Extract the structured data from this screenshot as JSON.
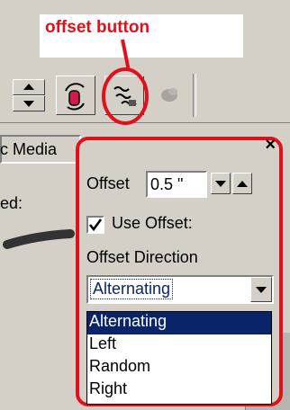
{
  "annotation": {
    "label": "offset button",
    "color": "#e0101c"
  },
  "toolbar": {
    "buttons": [
      {
        "icon": "spinner-up-down-icon"
      },
      {
        "icon": "color-rotate-icon"
      },
      {
        "icon": "offset-icon"
      },
      {
        "icon": "disabled-blob-icon"
      }
    ]
  },
  "background_panel": {
    "partial_text_1": "c Media",
    "partial_text_2": "ed:"
  },
  "popup": {
    "close_glyph": "×",
    "offset_label": "Offset",
    "offset_value": "0.5 \"",
    "use_offset_label": "Use Offset:",
    "use_offset_checked": true,
    "direction_label": "Offset Direction",
    "direction_selected": "Alternating",
    "direction_options": [
      "Alternating",
      "Left",
      "Random",
      "Right"
    ],
    "highlight_color": "#0a246a"
  }
}
